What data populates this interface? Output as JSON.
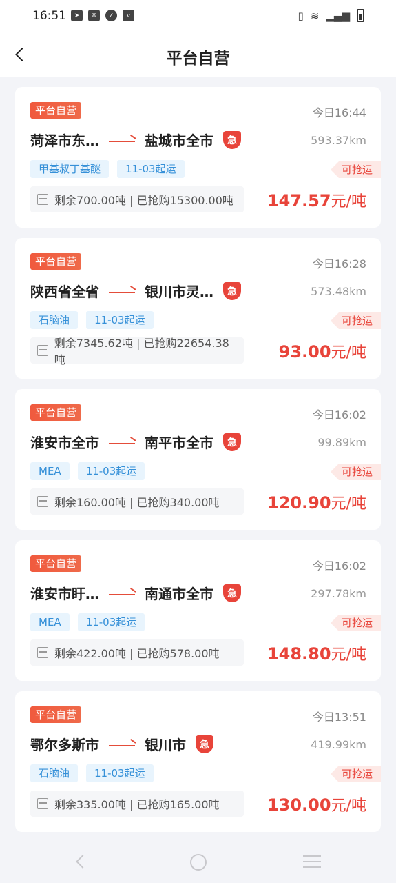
{
  "status_bar": {
    "time": "16:51",
    "left_icons": [
      "telegram-icon",
      "mail-icon",
      "check-icon",
      "vivo-icon"
    ],
    "right_icons": [
      "vibrate-icon",
      "wifi-icon",
      "signal-icon",
      "battery-icon"
    ]
  },
  "header": {
    "title": "平台自营"
  },
  "cards": [
    {
      "tag": "平台自营",
      "time": "今日16:44",
      "from": "菏泽市东…",
      "to": "盐城市全市",
      "urgent_label": "急",
      "distance": "593.37km",
      "chips": [
        "甲基叔丁基醚",
        "11-03起运"
      ],
      "grab_label": "可抢运",
      "stock": "剩余700.00吨 | 已抢购15300.00吨",
      "price": "147.57",
      "unit": "元/吨"
    },
    {
      "tag": "平台自营",
      "time": "今日16:28",
      "from": "陕西省全省",
      "to": "银川市灵…",
      "urgent_label": "急",
      "distance": "573.48km",
      "chips": [
        "石脑油",
        "11-03起运"
      ],
      "grab_label": "可抢运",
      "stock": "剩余7345.62吨 | 已抢购22654.38吨",
      "price": "93.00",
      "unit": "元/吨"
    },
    {
      "tag": "平台自营",
      "time": "今日16:02",
      "from": "淮安市全市",
      "to": "南平市全市",
      "urgent_label": "急",
      "distance": "99.89km",
      "chips": [
        "MEA",
        "11-03起运"
      ],
      "grab_label": "可抢运",
      "stock": "剩余160.00吨 | 已抢购340.00吨",
      "price": "120.90",
      "unit": "元/吨"
    },
    {
      "tag": "平台自营",
      "time": "今日16:02",
      "from": "淮安市盱…",
      "to": "南通市全市",
      "urgent_label": "急",
      "distance": "297.78km",
      "chips": [
        "MEA",
        "11-03起运"
      ],
      "grab_label": "可抢运",
      "stock": "剩余422.00吨 | 已抢购578.00吨",
      "price": "148.80",
      "unit": "元/吨"
    },
    {
      "tag": "平台自营",
      "time": "今日13:51",
      "from": "鄂尔多斯市",
      "to": "银川市",
      "urgent_label": "急",
      "distance": "419.99km",
      "chips": [
        "石脑油",
        "11-03起运"
      ],
      "grab_label": "可抢运",
      "stock": "剩余335.00吨 | 已抢购165.00吨",
      "price": "130.00",
      "unit": "元/吨"
    }
  ],
  "colors": {
    "accent_red": "#e8443a",
    "chip_blue": "#3590d8",
    "chip_bg": "#e8f4fd",
    "page_bg": "#f3f4f8"
  }
}
